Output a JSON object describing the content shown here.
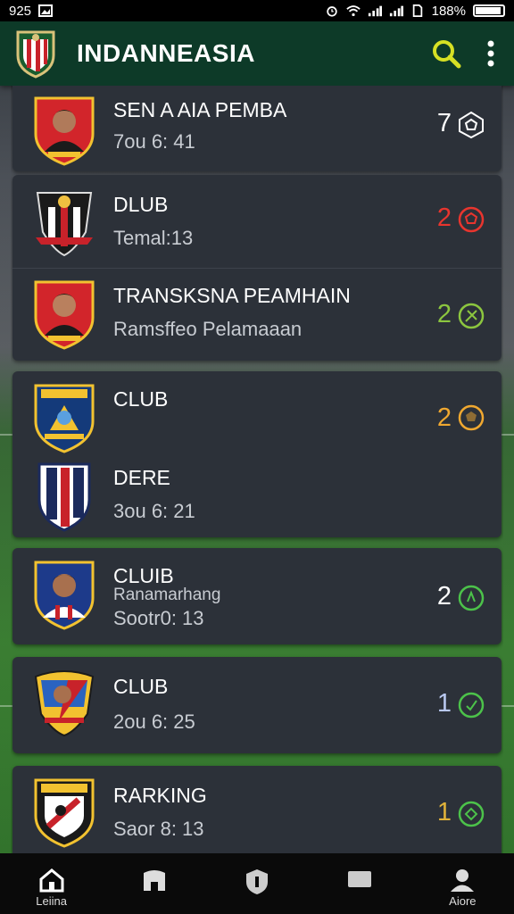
{
  "status_bar": {
    "time": "925",
    "battery": "188%"
  },
  "app_bar": {
    "title": "INDANNEASIA"
  },
  "rows": [
    {
      "title": "SEN A AIA PEMBA",
      "sub": "7ou 6: 41",
      "score": "7",
      "score_color": "#ffffff",
      "icon_color": "#ffffff"
    },
    {
      "title": "DLUB",
      "sub": "Temal:13",
      "score": "2",
      "score_color": "#e8352e",
      "icon_color": "#e8352e"
    },
    {
      "title": "TRANSKSNA PEAMHAIN",
      "sub": "Ramsffeo Pelamaaan",
      "score": "2",
      "score_color": "#8cc63f",
      "icon_color": "#8cc63f"
    },
    {
      "title": "CLUB",
      "sub": "",
      "score": "2",
      "score_color": "#f0a830",
      "icon_color": "#f0a830"
    },
    {
      "title": "DERE",
      "sub": "3ou 6: 21",
      "score": "",
      "score_color": "#ffffff",
      "icon_color": "#ffffff"
    },
    {
      "title": "CLUIB",
      "sub2": "Ranamarhang",
      "sub": "Sootr0: 13",
      "score": "2",
      "score_color": "#ffffff",
      "icon_color": "#4cc24a"
    },
    {
      "title": "CLUB",
      "sub": "2ou 6: 25",
      "score": "1",
      "score_color": "#b9c8f0",
      "icon_color": "#4cc24a"
    },
    {
      "title": "RARKING",
      "sub": "Saor 8: 13",
      "score": "1",
      "score_color": "#e0b23a",
      "icon_color": "#4cc24a"
    }
  ],
  "bottom_nav": [
    {
      "label": "Leiina",
      "icon": "home-icon"
    },
    {
      "label": "",
      "icon": "team-icon"
    },
    {
      "label": "",
      "icon": "shield-icon"
    },
    {
      "label": "",
      "icon": "chat-icon"
    },
    {
      "label": "Aiore",
      "icon": "profile-icon"
    }
  ]
}
